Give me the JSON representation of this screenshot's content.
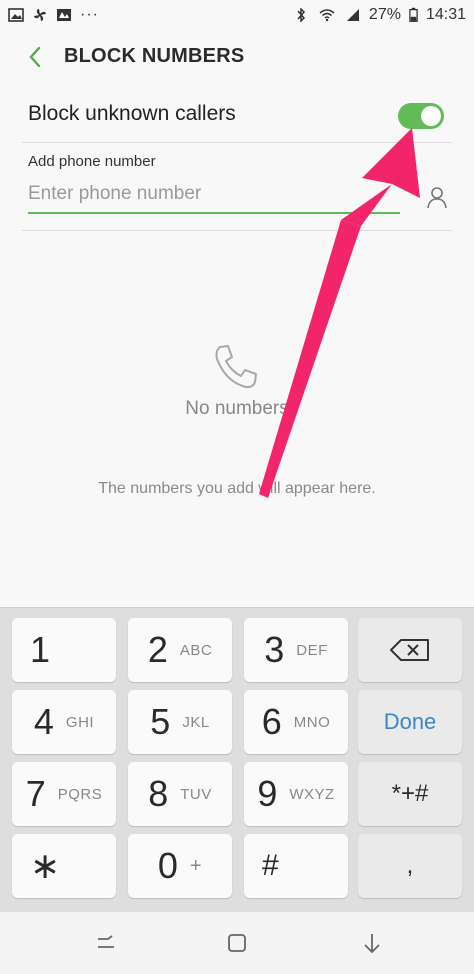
{
  "status_bar": {
    "dots": "···",
    "battery": "27%",
    "time": "14:31"
  },
  "header": {
    "title": "BLOCK NUMBERS"
  },
  "block_unknown": {
    "label": "Block unknown callers",
    "enabled": true
  },
  "add_phone": {
    "label": "Add phone number",
    "placeholder": "Enter phone number",
    "value": ""
  },
  "empty_state": {
    "title": "No numbers",
    "description": "The numbers you add will appear here."
  },
  "keypad": {
    "rows": [
      [
        {
          "num": "1",
          "sub": ""
        },
        {
          "num": "2",
          "sub": "ABC"
        },
        {
          "num": "3",
          "sub": "DEF"
        }
      ],
      [
        {
          "num": "4",
          "sub": "GHI"
        },
        {
          "num": "5",
          "sub": "JKL"
        },
        {
          "num": "6",
          "sub": "MNO"
        }
      ],
      [
        {
          "num": "7",
          "sub": "PQRS"
        },
        {
          "num": "8",
          "sub": "TUV"
        },
        {
          "num": "9",
          "sub": "WXYZ"
        }
      ],
      [
        {
          "num": "∗",
          "sub": ""
        },
        {
          "num": "0",
          "sub": "+"
        },
        {
          "num": "#",
          "sub": ""
        }
      ]
    ],
    "done_label": "Done",
    "special_label": "*+#",
    "comma_label": ","
  },
  "colors": {
    "accent_green": "#62bb58",
    "done_blue": "#3a86c9",
    "annotation_pink": "#f2246a"
  }
}
